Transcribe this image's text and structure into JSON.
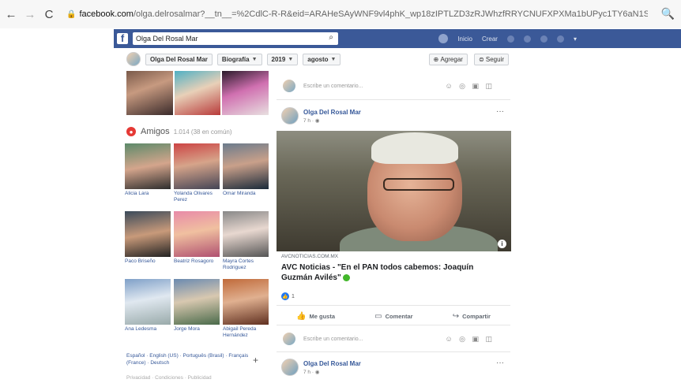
{
  "browser": {
    "back": "←",
    "forward": "→",
    "reload": "C",
    "lock": "🔒",
    "url_domain": "facebook.com",
    "url_rest": "/olga.delrosalmar?__tn__=%2CdlC-R-R&eid=ARAHeSAyWNF9vl4phK_wp18zIPTLZD3zRJWhzfRRYCNUFXPXMa1bUPyc1TY6aN1SFq1455ImFzI&hc...",
    "search_glyph": "🔍"
  },
  "fb": {
    "logo": "f",
    "search_value": "Olga Del Rosal Mar",
    "nav_home": "Inicio",
    "nav_create": "Crear"
  },
  "profile_nav": {
    "name": "Olga Del Rosal Mar",
    "biography": "Biografía",
    "year": "2019",
    "month": "agosto",
    "add_friend": "Agregar",
    "follow": "Seguir"
  },
  "friends": {
    "title": "Amigos",
    "count": "1.014 (38 en común)",
    "items": [
      {
        "name": "Alicia Lara"
      },
      {
        "name": "Yolanda Olivares Perez"
      },
      {
        "name": "Omar Miranda"
      },
      {
        "name": "Paco Briseño"
      },
      {
        "name": "Beatriz Rosagoro"
      },
      {
        "name": "Mayra Cortes Rodriguez"
      },
      {
        "name": "Ana Ledesma"
      },
      {
        "name": "Jorge Mora"
      },
      {
        "name": "Abigail Pereda Hernández"
      }
    ]
  },
  "languages": "Español · English (US) · Português (Brasil) · Français (France) · Deutsch",
  "footer": "Privacidad · Condiciones · Publicidad",
  "composer": {
    "placeholder": "Escribe un comentario...",
    "icons": "☺ ◎ ▣ ◫"
  },
  "post": {
    "author": "Olga Del Rosal Mar",
    "time": "7 h · ◉",
    "more": "···",
    "link_source": "AVCNOTICIAS.COM.MX",
    "link_title": "AVC Noticias - \"En el PAN todos cabemos: Joaquín Guzmán Avilés\"",
    "info": "i",
    "reaction_count": "1",
    "like": "Me gusta",
    "comment": "Comentar",
    "share": "Compartir"
  },
  "post2": {
    "author": "Olga Del Rosal Mar",
    "time": "7 h · ◉",
    "more": "···"
  }
}
